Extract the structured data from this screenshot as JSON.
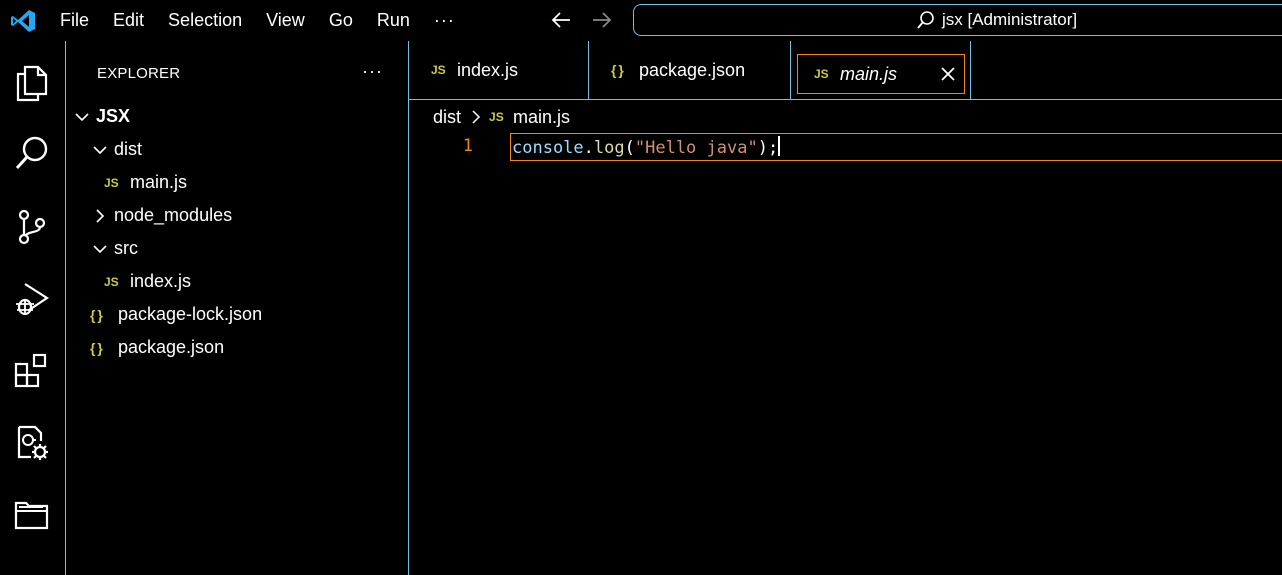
{
  "titlebar": {
    "menu": [
      "File",
      "Edit",
      "Selection",
      "View",
      "Go",
      "Run"
    ],
    "more": "···",
    "command_center": "jsx [Administrator]"
  },
  "activity_bar": {
    "icons": [
      "files-icon",
      "search-icon",
      "source-control-icon",
      "run-debug-icon",
      "extensions-icon",
      "remote-explorer-icon",
      "folder-icon"
    ]
  },
  "sidebar": {
    "title": "EXPLORER",
    "more": "···",
    "tree": [
      {
        "label": "JSX",
        "type": "root",
        "expanded": true
      },
      {
        "label": "dist",
        "type": "folder",
        "expanded": true
      },
      {
        "label": "main.js",
        "type": "js"
      },
      {
        "label": "node_modules",
        "type": "folder",
        "expanded": false
      },
      {
        "label": "src",
        "type": "folder",
        "expanded": true
      },
      {
        "label": "index.js",
        "type": "js"
      },
      {
        "label": "package-lock.json",
        "type": "json"
      },
      {
        "label": "package.json",
        "type": "json"
      }
    ]
  },
  "tabs": [
    {
      "label": "index.js",
      "icon": "JS",
      "active": false
    },
    {
      "label": "package.json",
      "icon": "{ }",
      "active": false
    },
    {
      "label": "main.js",
      "icon": "JS",
      "active": true
    }
  ],
  "breadcrumb": {
    "folder": "dist",
    "file": "main.js",
    "file_icon": "JS"
  },
  "editor": {
    "line_number": "1",
    "tokens": {
      "object": "console",
      "dot": ".",
      "method": "log",
      "open": "(",
      "string": "\"Hello java\"",
      "close": ");"
    }
  },
  "colors": {
    "accent_border": "#6fc3df",
    "active_border": "#f38518",
    "js_icon": "#cbcb41"
  }
}
